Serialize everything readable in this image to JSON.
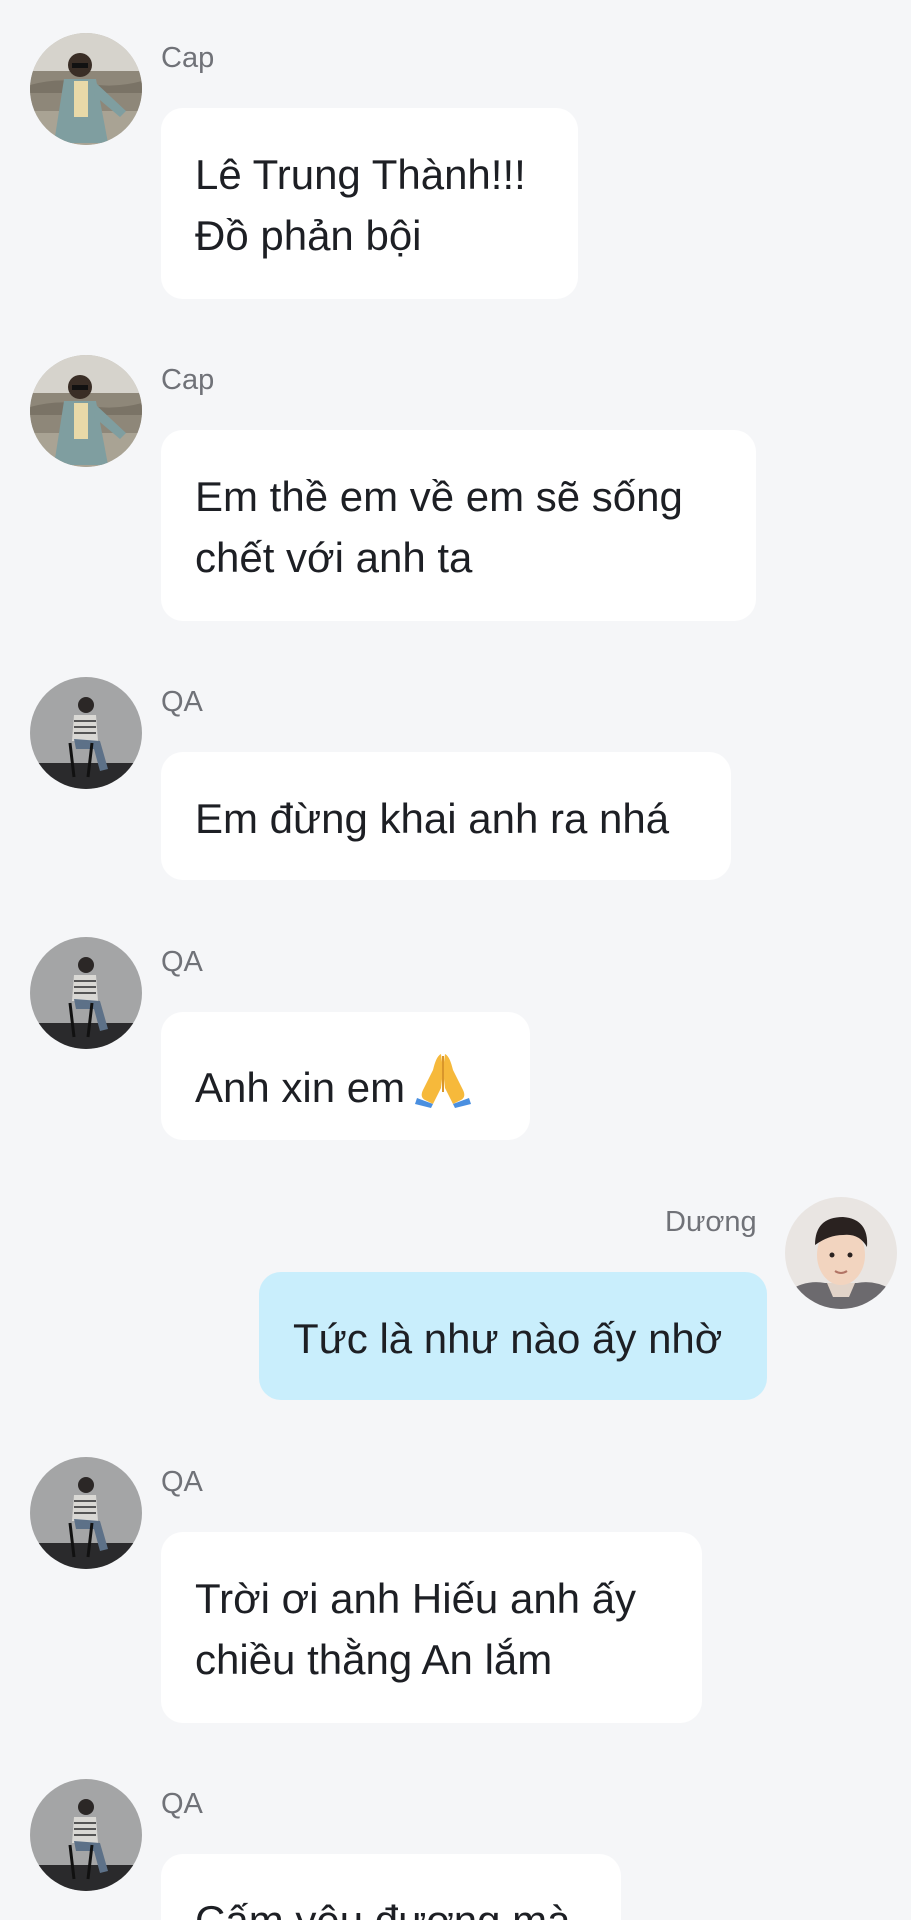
{
  "messages": [
    {
      "sender": "Cap",
      "avatar": "cap-avatar",
      "side": "left",
      "lines": [
        "Lê Trung Thành!!!",
        "Đồ phản bội"
      ]
    },
    {
      "sender": "Cap",
      "avatar": "cap-avatar",
      "side": "left",
      "lines": [
        "Em thề em về em sẽ sống",
        "chết với anh ta"
      ]
    },
    {
      "sender": "QA",
      "avatar": "qa-avatar",
      "side": "left",
      "lines": [
        "Em đừng khai anh ra nhá"
      ]
    },
    {
      "sender": "QA",
      "avatar": "qa-avatar",
      "side": "left",
      "lines": [
        "Anh xin em"
      ],
      "emoji": "folded-hands-emoji"
    },
    {
      "sender": "Dương",
      "avatar": "duong-avatar",
      "side": "right",
      "lines": [
        "Tức là như nào ấy nhờ"
      ]
    },
    {
      "sender": "QA",
      "avatar": "qa-avatar",
      "side": "left",
      "lines": [
        "Trời ơi anh Hiếu anh ấy",
        "chiều thằng An lắm"
      ]
    },
    {
      "sender": "QA",
      "avatar": "qa-avatar",
      "side": "left",
      "lines": [
        "Cấm yêu đương mà"
      ]
    }
  ],
  "colors": {
    "background": "#f5f6f8",
    "incoming_bubble": "#ffffff",
    "outgoing_bubble": "#c9eefc",
    "sender_name": "#707278",
    "message_text": "#1d1f24"
  }
}
